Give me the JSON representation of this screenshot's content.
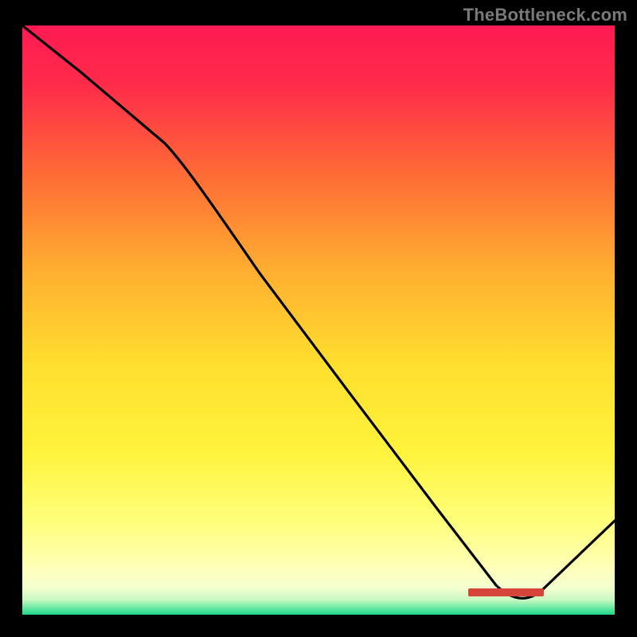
{
  "watermark": "TheBottleneck.com",
  "colors": {
    "frame": "#000000",
    "curve": "#000000",
    "label_block": "#d7443a",
    "gradient_stops": [
      {
        "offset": 0.0,
        "color": "#ff1a52"
      },
      {
        "offset": 0.1,
        "color": "#ff2b4a"
      },
      {
        "offset": 0.25,
        "color": "#ff6a36"
      },
      {
        "offset": 0.42,
        "color": "#ffb030"
      },
      {
        "offset": 0.58,
        "color": "#ffe02e"
      },
      {
        "offset": 0.72,
        "color": "#fff23a"
      },
      {
        "offset": 0.84,
        "color": "#ffff7a"
      },
      {
        "offset": 0.92,
        "color": "#ffffb8"
      },
      {
        "offset": 0.955,
        "color": "#f3ffd0"
      },
      {
        "offset": 0.975,
        "color": "#c8f8c2"
      },
      {
        "offset": 0.99,
        "color": "#5ee7a0"
      },
      {
        "offset": 1.0,
        "color": "#1fd486"
      }
    ]
  },
  "chart_data": {
    "type": "line",
    "title": "",
    "xlabel": "",
    "ylabel": "",
    "xlim": [
      0,
      100
    ],
    "ylim": [
      0,
      100
    ],
    "grid": false,
    "legend": false,
    "series": [
      {
        "name": "curve",
        "x": [
          0,
          10,
          24,
          40,
          55,
          70,
          80,
          86,
          100
        ],
        "y": [
          100,
          92,
          80,
          58,
          38,
          18,
          5,
          2,
          16
        ]
      }
    ],
    "annotations": [
      {
        "name": "red-block",
        "x_range": [
          75,
          88
        ],
        "y": 3
      }
    ]
  }
}
